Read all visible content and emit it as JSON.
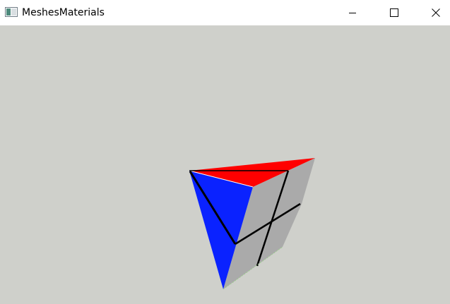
{
  "window": {
    "title": "MeshesMaterials",
    "icon": "app-window-icon",
    "controls": {
      "minimize_icon": "minimize-icon",
      "maximize_icon": "maximize-icon",
      "close_icon": "close-icon"
    }
  },
  "viewport": {
    "background_color": "#cfd0cb",
    "mesh": {
      "name": "wedge-mesh",
      "face_colors": {
        "top": "#ff0000",
        "left": "#0a22ff",
        "right": "#aaaaaa",
        "edges": "#000000"
      }
    }
  }
}
